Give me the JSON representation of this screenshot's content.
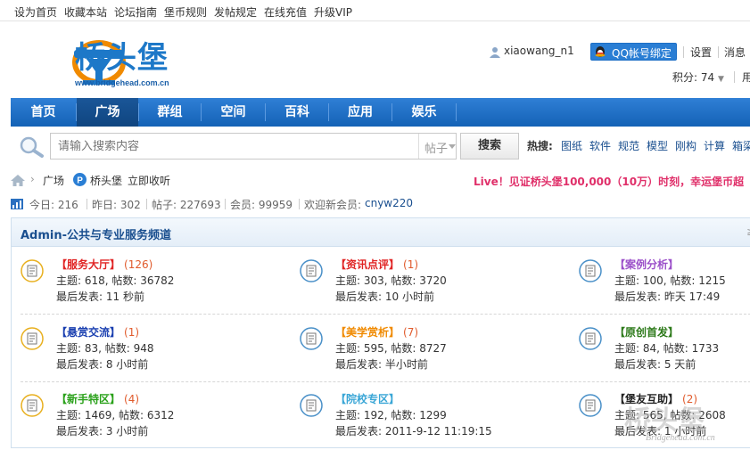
{
  "toplinks": [
    "设为首页",
    "收藏本站",
    "论坛指南",
    "堡币规则",
    "发帖规定",
    "在线充值",
    "升级VIP"
  ],
  "header": {
    "logo_text": "桥头堡",
    "logo_url": "www.bridgehead.com.cn",
    "username": "xiaowang_n1",
    "qq_button": "QQ帐号绑定",
    "settings": "设置",
    "messages": "消息",
    "score": "积分: 74",
    "score_extra": "用"
  },
  "nav": {
    "items": [
      "首页",
      "广场",
      "群组",
      "空间",
      "百科",
      "应用",
      "娱乐"
    ],
    "active": "广场"
  },
  "search": {
    "placeholder": "请输入搜索内容",
    "type": "帖子",
    "button": "搜索",
    "hot_label": "热搜:",
    "hot_items": [
      "图纸",
      "软件",
      "规范",
      "模型",
      "刚构",
      "计算",
      "箱梁"
    ]
  },
  "breadcrumb": {
    "items": [
      "广场",
      "桥头堡"
    ],
    "action": "立即收听"
  },
  "announcement": "Live！见证桥头堡100,000（10万）时刻，幸运堡币超",
  "stats": {
    "today": "今日: 216",
    "yesterday": "昨日: 302",
    "posts": "帖子: 227693",
    "members": "会员: 99959",
    "welcome": "欢迎新会员:",
    "new_member": "cnyw220"
  },
  "section": {
    "title": "Admin-公共与专业服务频道",
    "collapse": "≥"
  },
  "forums": [
    {
      "name": "【服务大厅】",
      "count": "(126)",
      "color": "#e02424",
      "topics": "主题: 618, 帖数: 36782",
      "last": "最后发表: 11 秒前"
    },
    {
      "name": "【资讯点评】",
      "count": "(1)",
      "color": "#e02424",
      "topics": "主题: 303, 帖数: 3720",
      "last": "最后发表: 10 小时前"
    },
    {
      "name": "【案例分析】",
      "count": "",
      "color": "#9b4fc9",
      "topics": "主题: 100, 帖数: 1215",
      "last": "最后发表: 昨天 17:49"
    },
    {
      "name": "【悬赏交流】",
      "count": "(1)",
      "color": "#1a3fb0",
      "topics": "主题: 83, 帖数: 948",
      "last": "最后发表: 8 小时前"
    },
    {
      "name": "【美学赏析】",
      "count": "(7)",
      "color": "#f08a00",
      "topics": "主题: 595, 帖数: 8727",
      "last": "最后发表: 半小时前"
    },
    {
      "name": "【原创首发】",
      "count": "",
      "color": "#2d7a1a",
      "topics": "主题: 84, 帖数: 1733",
      "last": "最后发表: 5 天前"
    },
    {
      "name": "【新手特区】",
      "count": "(4)",
      "color": "#2aa11a",
      "topics": "主题: 1469, 帖数: 6312",
      "last": "最后发表: 3 小时前"
    },
    {
      "name": "【院校专区】",
      "count": "",
      "color": "#3aa6d6",
      "topics": "主题: 192, 帖数: 1299",
      "last": "最后发表: 2011-9-12 11:19:15"
    },
    {
      "name": "【堡友互助】",
      "count": "(2)",
      "color": "#222222",
      "topics": "主题: 565, 帖数: 2608",
      "last": "最后发表: 1 小时前"
    }
  ],
  "watermark": {
    "text": "桥头堡",
    "url": "Bridgehead.com.cn"
  },
  "colors": {
    "nav_blue": "#1f6fc8",
    "link_blue": "#1a4f8f",
    "live_pink": "#e0306a",
    "count_orange": "#e05a2b"
  }
}
